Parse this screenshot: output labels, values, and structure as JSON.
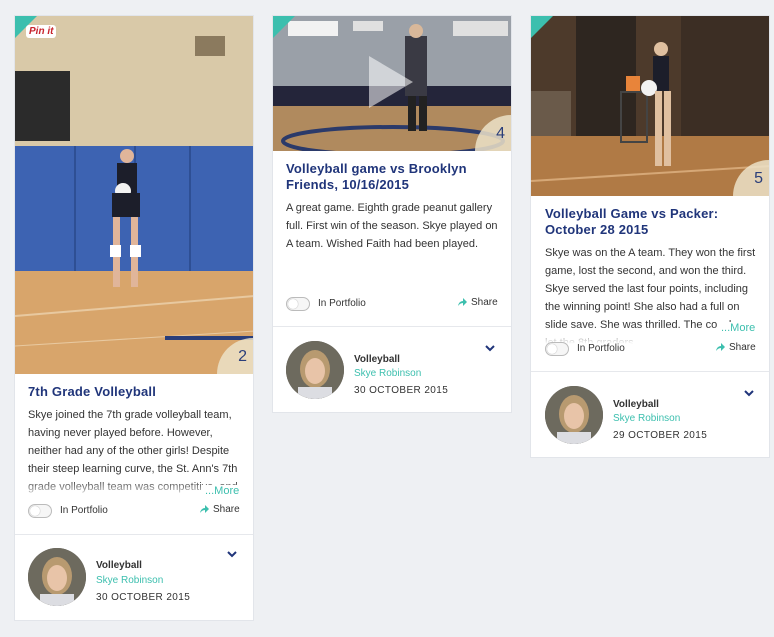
{
  "cards": [
    {
      "pin_label": "Pin it",
      "count": "2",
      "title": "7th Grade Volleyball",
      "body": "Skye joined the 7th grade volleyball team, having never played before. However, neither had any of the other girls! Despite their steep learning curve, the St. Ann's 7th grade volleyball team was competitive, and",
      "more": "...More",
      "portfolio": "In Portfolio",
      "share": "Share",
      "category": "Volleyball",
      "author": "Skye Robinson",
      "date": "30 OCTOBER 2015"
    },
    {
      "count": "4",
      "title": "Volleyball game vs Brooklyn Friends, 10/16/2015",
      "body": "A great game. Eighth grade peanut gallery full. First win of the season. Skye played on A team. Wished Faith had been played.",
      "portfolio": "In Portfolio",
      "share": "Share",
      "category": "Volleyball",
      "author": "Skye Robinson",
      "date": "30 OCTOBER 2015"
    },
    {
      "count": "5",
      "title": "Volleyball Game vs Packer: October 28 2015",
      "body": "Skye was on the A team. They won the first game, lost the second, and won the third. Skye served the last four points, including the winning point! She also had a full on slide save. She was thrilled. The coaches let the 8th graders",
      "more": "...More",
      "portfolio": "In Portfolio",
      "share": "Share",
      "category": "Volleyball",
      "author": "Skye Robinson",
      "date": "29 OCTOBER 2015"
    }
  ],
  "colors": {
    "accent": "#3cbfae",
    "title": "#20357a",
    "count_bg": "#ece2c8"
  },
  "icons": [
    "pin-it-logo",
    "play-icon",
    "share-icon",
    "chevron-down-icon",
    "corner-tag-icon"
  ]
}
